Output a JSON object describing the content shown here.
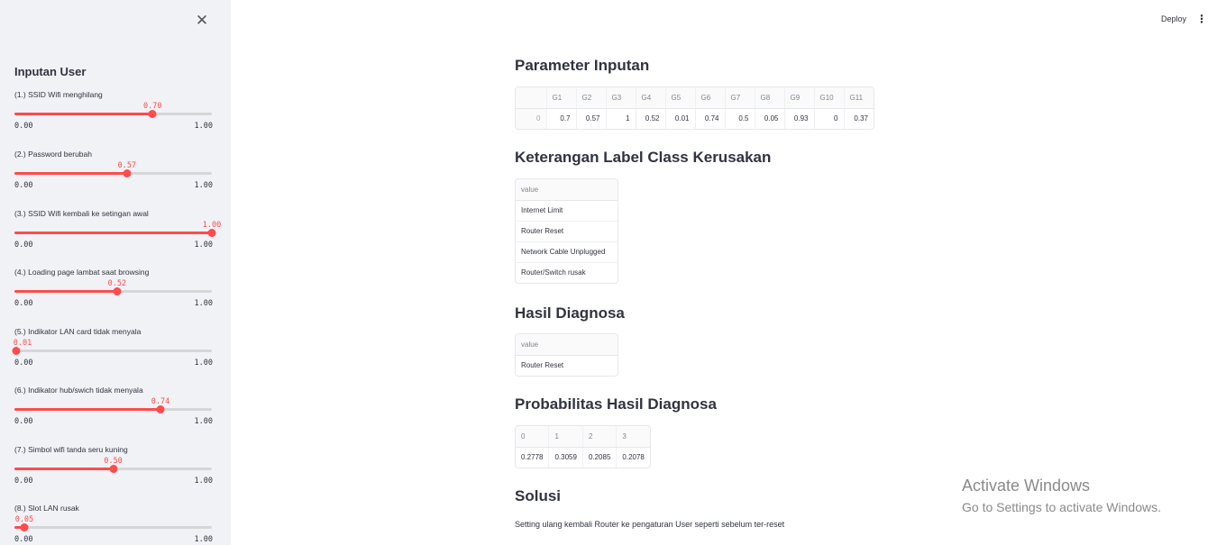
{
  "sidebar": {
    "heading": "Inputan User",
    "close_icon": "close-icon",
    "sliders": [
      {
        "label": "(1.) SSID Wifi menghilang",
        "value": "0.70",
        "fraction": 0.7,
        "min": "0.00",
        "max": "1.00"
      },
      {
        "label": "(2.) Password berubah",
        "value": "0.57",
        "fraction": 0.57,
        "min": "0.00",
        "max": "1.00"
      },
      {
        "label": "(3.) SSID Wifi kembali ke setingan awal",
        "value": "1.00",
        "fraction": 1.0,
        "min": "0.00",
        "max": "1.00"
      },
      {
        "label": "(4.) Loading page lambat saat browsing",
        "value": "0.52",
        "fraction": 0.52,
        "min": "0.00",
        "max": "1.00"
      },
      {
        "label": "(5.) Indikator LAN card tidak menyala",
        "value": "0.01",
        "fraction": 0.01,
        "min": "0.00",
        "max": "1.00"
      },
      {
        "label": "(6.) Indikator hub/swich tidak menyala",
        "value": "0.74",
        "fraction": 0.74,
        "min": "0.00",
        "max": "1.00"
      },
      {
        "label": "(7.) Simbol wifi tanda seru kuning",
        "value": "0.50",
        "fraction": 0.5,
        "min": "0.00",
        "max": "1.00"
      },
      {
        "label": "(8.) Slot LAN rusak",
        "value": "0.05",
        "fraction": 0.05,
        "min": "0.00",
        "max": "1.00"
      }
    ]
  },
  "toolbar": {
    "deploy_label": "Deploy",
    "menu_icon": "more-vertical-icon"
  },
  "main": {
    "param_heading": "Parameter Inputan",
    "param_table": {
      "headers": [
        "",
        "G1",
        "G2",
        "G3",
        "G4",
        "G5",
        "G6",
        "G7",
        "G8",
        "G9",
        "G10",
        "G11"
      ],
      "rows": [
        [
          "0",
          "0.7",
          "0.57",
          "1",
          "0.52",
          "0.01",
          "0.74",
          "0.5",
          "0.05",
          "0.93",
          "0",
          "0.37"
        ]
      ]
    },
    "label_heading": "Keterangan Label Class Kerusakan",
    "label_table": {
      "headers": [
        "value"
      ],
      "rows": [
        [
          "Internet Limit"
        ],
        [
          "Router Reset"
        ],
        [
          "Network Cable Unplugged"
        ],
        [
          "Router/Switch rusak"
        ]
      ]
    },
    "diag_heading": "Hasil Diagnosa",
    "diag_table": {
      "headers": [
        "value"
      ],
      "rows": [
        [
          "Router Reset"
        ]
      ]
    },
    "prob_heading": "Probabilitas Hasil Diagnosa",
    "prob_table": {
      "headers": [
        "0",
        "1",
        "2",
        "3"
      ],
      "rows": [
        [
          "0.2778",
          "0.3059",
          "0.2085",
          "0.2078"
        ]
      ]
    },
    "solusi_heading": "Solusi",
    "solusi_text": "Setting ulang kembali Router ke pengaturan User seperti sebelum ter-reset"
  },
  "watermark": {
    "line1": "Activate Windows",
    "line2": "Go to Settings to activate Windows."
  }
}
